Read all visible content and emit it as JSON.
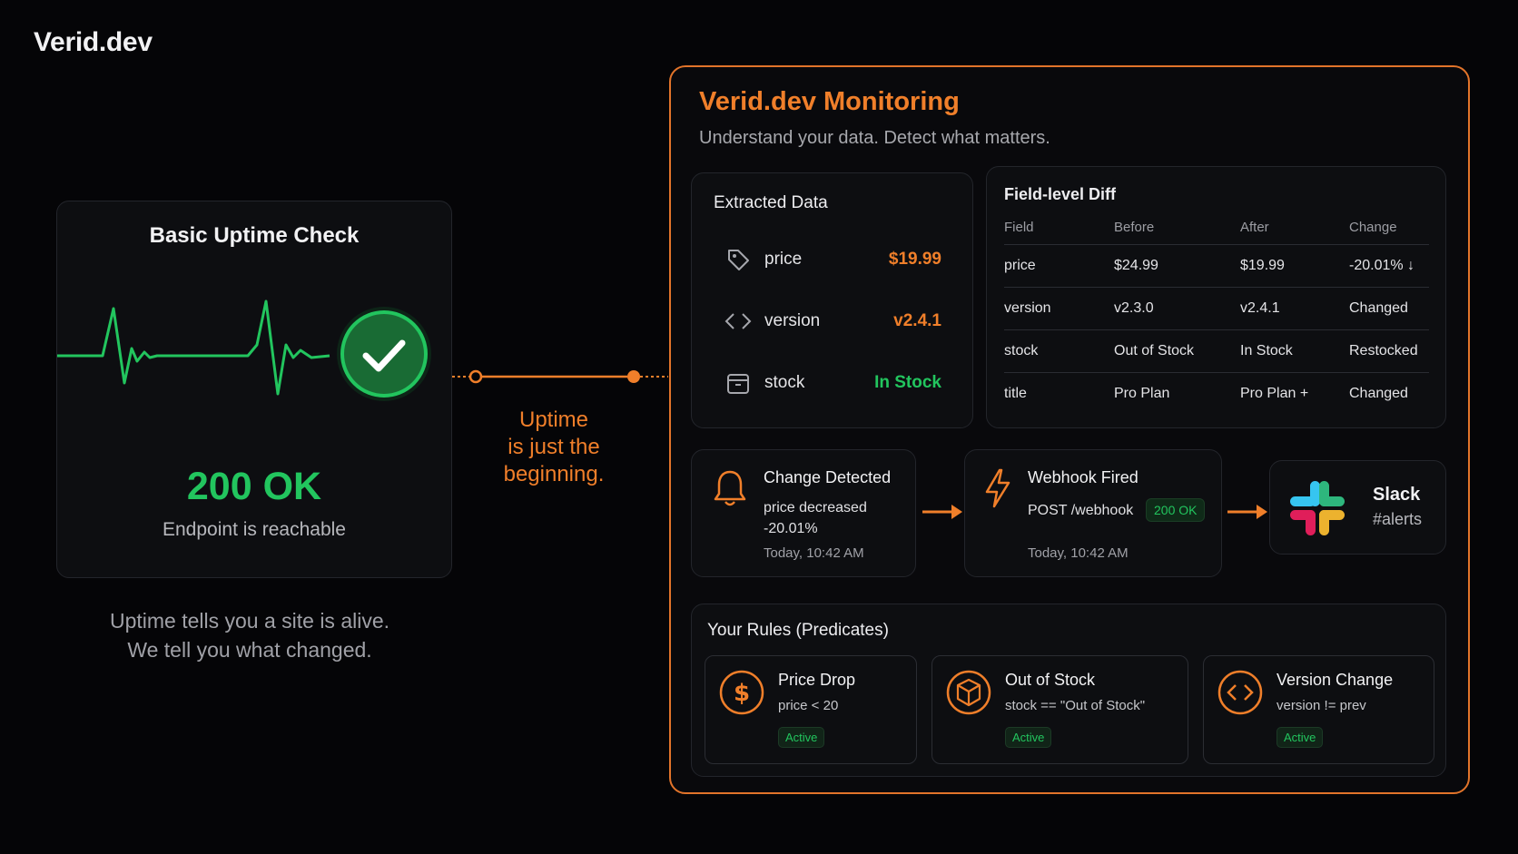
{
  "brand": "Verid.dev",
  "uptime": {
    "title": "Basic Uptime Check",
    "status": "200 OK",
    "subtitle": "Endpoint is reachable",
    "tagline_1": "Uptime tells you a site is alive.",
    "tagline_2": "We tell you what changed."
  },
  "bridge": {
    "line_1": "Uptime",
    "line_2": "is just the",
    "line_3": "beginning."
  },
  "monitoring": {
    "title": "Verid.dev Monitoring",
    "subtitle": "Understand your data. Detect what matters.",
    "extracted": {
      "title": "Extracted Data",
      "items": [
        {
          "icon": "tag-icon",
          "label": "price",
          "value": "$19.99",
          "color": "#f07f2a"
        },
        {
          "icon": "code-icon",
          "label": "version",
          "value": "v2.4.1",
          "color": "#f07f2a"
        },
        {
          "icon": "box-icon",
          "label": "stock",
          "value": "In Stock",
          "color": "#22c55e"
        }
      ]
    },
    "diff": {
      "title": "Field-level Diff",
      "columns": [
        "Field",
        "Before",
        "After",
        "Change"
      ],
      "rows": [
        {
          "field": "price",
          "before": "$24.99",
          "after": "$19.99",
          "change": "-20.01% ↓"
        },
        {
          "field": "version",
          "before": "v2.3.0",
          "after": "v2.4.1",
          "change": "Changed"
        },
        {
          "field": "stock",
          "before": "Out of Stock",
          "after": "In Stock",
          "change": "Restocked"
        },
        {
          "field": "title",
          "before": "Pro Plan",
          "after": "Pro Plan +",
          "change": "Changed"
        }
      ]
    },
    "change_detected": {
      "title": "Change Detected",
      "text": "price decreased",
      "value": "-20.01%",
      "time": "Today, 10:42 AM"
    },
    "webhook": {
      "title": "Webhook Fired",
      "text": "POST /webhook",
      "badge": "200 OK",
      "time": "Today, 10:42 AM"
    },
    "slack": {
      "title": "Slack",
      "channel": "#alerts"
    },
    "rules": {
      "title": "Your Rules (Predicates)",
      "items": [
        {
          "icon": "dollar-icon",
          "title": "Price Drop",
          "expr": "price < 20",
          "badge": "Active"
        },
        {
          "icon": "cube-icon",
          "title": "Out of Stock",
          "expr": "stock == \"Out of Stock\"",
          "badge": "Active"
        },
        {
          "icon": "code-icon",
          "title": "Version Change",
          "expr": "version != prev",
          "badge": "Active"
        }
      ]
    }
  },
  "colors": {
    "accent": "#f07f2a",
    "success": "#22c55e",
    "background": "#050507"
  }
}
